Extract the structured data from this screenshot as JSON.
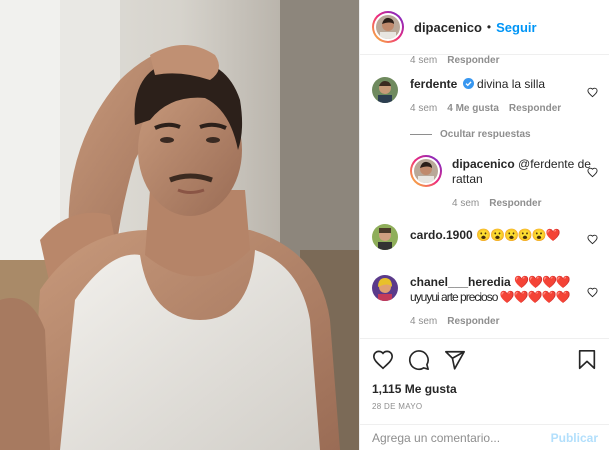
{
  "post": {
    "author": "dipacenico",
    "separator": "•",
    "follow_label": "Seguir",
    "likes": "1,115 Me gusta",
    "date": "28 DE MAYO"
  },
  "comments": [
    {
      "meta_time": "4 sem",
      "reply_label": "Responder"
    },
    {
      "username": "ferdente",
      "text": "divina la silla",
      "verified": true,
      "time": "4 sem",
      "likes": "4 Me gusta",
      "reply_label": "Responder"
    },
    {
      "username": "dipacenico",
      "text": "@ferdente de rattan",
      "time": "4 sem",
      "reply_label": "Responder"
    },
    {
      "username": "cardo.1900",
      "text": "😮😮😮😮😮❤️"
    },
    {
      "username": "chanel___heredia",
      "text": "❤️❤️❤️❤️ uyuyui arte precioso ❤️❤️❤️❤️❤️",
      "time": "4 sem",
      "reply_label": "Responder"
    }
  ],
  "hide_replies_label": "Ocultar respuestas",
  "add_comment": {
    "placeholder": "Agrega un comentario...",
    "publish_label": "Publicar"
  },
  "icons": [
    "heart-icon",
    "comment-icon",
    "share-icon",
    "bookmark-icon",
    "verified-icon"
  ],
  "colors": {
    "accent": "#0095f6",
    "publish_disabled": "#b2dffc",
    "muted": "#8e8e8e",
    "text": "#262626"
  }
}
